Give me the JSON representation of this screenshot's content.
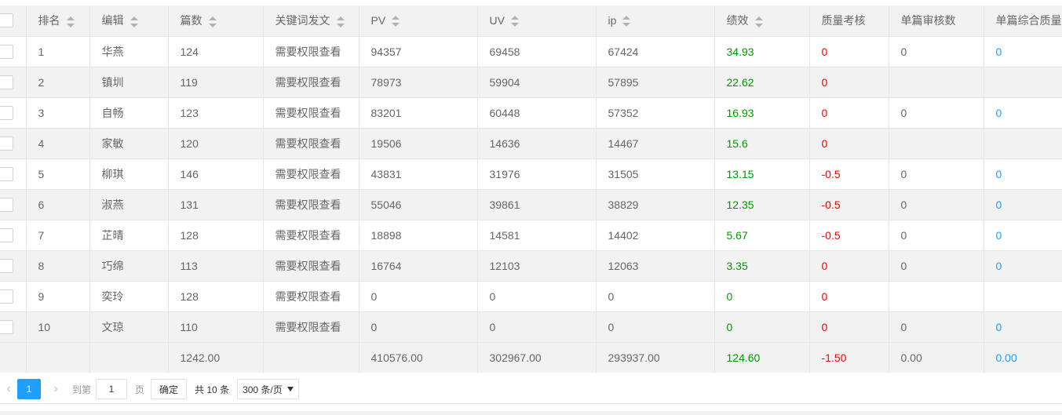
{
  "table": {
    "headers": {
      "rank": "排名",
      "editor": "编辑",
      "articles": "篇数",
      "keyword_post": "关键词发文",
      "pv": "PV",
      "uv": "UV",
      "ip": "ip",
      "performance": "绩效",
      "quality_check": "质量考核",
      "single_review_count": "单篇审核数",
      "single_quality": "单篇综合质量"
    },
    "rows": [
      {
        "rank": "1",
        "editor": "华燕",
        "articles": "124",
        "keyword_post": "需要权限查看",
        "pv": "94357",
        "uv": "69458",
        "ip": "67424",
        "performance": "34.93",
        "quality_check": "0",
        "single_review_count": "0",
        "single_quality": "0"
      },
      {
        "rank": "2",
        "editor": "镇圳",
        "articles": "119",
        "keyword_post": "需要权限查看",
        "pv": "78973",
        "uv": "59904",
        "ip": "57895",
        "performance": "22.62",
        "quality_check": "0",
        "single_review_count": "",
        "single_quality": ""
      },
      {
        "rank": "3",
        "editor": "自畅",
        "articles": "123",
        "keyword_post": "需要权限查看",
        "pv": "83201",
        "uv": "60448",
        "ip": "57352",
        "performance": "16.93",
        "quality_check": "0",
        "single_review_count": "0",
        "single_quality": "0"
      },
      {
        "rank": "4",
        "editor": "家敏",
        "articles": "120",
        "keyword_post": "需要权限查看",
        "pv": "19506",
        "uv": "14636",
        "ip": "14467",
        "performance": "15.6",
        "quality_check": "0",
        "single_review_count": "",
        "single_quality": ""
      },
      {
        "rank": "5",
        "editor": "柳琪",
        "articles": "146",
        "keyword_post": "需要权限查看",
        "pv": "43831",
        "uv": "31976",
        "ip": "31505",
        "performance": "13.15",
        "quality_check": "-0.5",
        "single_review_count": "0",
        "single_quality": "0"
      },
      {
        "rank": "6",
        "editor": "淑燕",
        "articles": "131",
        "keyword_post": "需要权限查看",
        "pv": "55046",
        "uv": "39861",
        "ip": "38829",
        "performance": "12.35",
        "quality_check": "-0.5",
        "single_review_count": "0",
        "single_quality": "0"
      },
      {
        "rank": "7",
        "editor": "芷晴",
        "articles": "128",
        "keyword_post": "需要权限查看",
        "pv": "18898",
        "uv": "14581",
        "ip": "14402",
        "performance": "5.67",
        "quality_check": "-0.5",
        "single_review_count": "0",
        "single_quality": "0"
      },
      {
        "rank": "8",
        "editor": "巧绵",
        "articles": "113",
        "keyword_post": "需要权限查看",
        "pv": "16764",
        "uv": "12103",
        "ip": "12063",
        "performance": "3.35",
        "quality_check": "0",
        "single_review_count": "0",
        "single_quality": "0"
      },
      {
        "rank": "9",
        "editor": "奕玲",
        "articles": "128",
        "keyword_post": "需要权限查看",
        "pv": "0",
        "uv": "0",
        "ip": "0",
        "performance": "0",
        "quality_check": "0",
        "single_review_count": "",
        "single_quality": ""
      },
      {
        "rank": "10",
        "editor": "文琼",
        "articles": "110",
        "keyword_post": "需要权限查看",
        "pv": "0",
        "uv": "0",
        "ip": "0",
        "performance": "0",
        "quality_check": "0",
        "single_review_count": "0",
        "single_quality": "0"
      }
    ],
    "totals": {
      "articles": "1242.00",
      "pv": "410576.00",
      "uv": "302967.00",
      "ip": "293937.00",
      "performance": "124.60",
      "quality_check": "-1.50",
      "single_review_count": "0.00",
      "single_quality": "0.00"
    }
  },
  "pager": {
    "prev_icon": "chevron-left-icon",
    "current_page": "1",
    "next_icon": "chevron-right-icon",
    "goto_label": "到第",
    "goto_value": "1",
    "page_unit": "页",
    "confirm_label": "确定",
    "total_label": "共 10 条",
    "page_size": "300 条/页"
  },
  "colors": {
    "performance": "#009900",
    "quality_check": "#ff0000",
    "single_quality": "#1E9FFF",
    "accent": "#1E9FFF",
    "header_bg": "#f2f2f2"
  }
}
